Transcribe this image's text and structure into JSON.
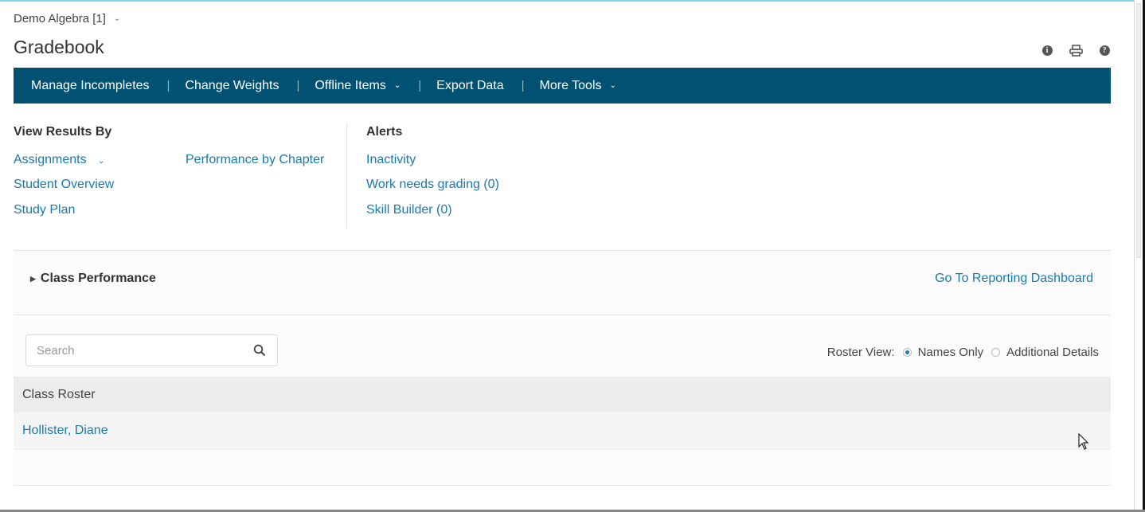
{
  "course": {
    "name": "Demo Algebra [1]",
    "icon": "chevron-down-icon"
  },
  "header": {
    "title": "Gradebook",
    "icons": [
      "info-icon",
      "print-icon",
      "help-icon"
    ]
  },
  "navbar": {
    "bg_color": "#005172",
    "items": [
      {
        "label": "Manage Incompletes",
        "has_dropdown": false
      },
      {
        "label": "Change Weights",
        "has_dropdown": false
      },
      {
        "label": "Offline Items",
        "has_dropdown": true
      },
      {
        "label": "Export Data",
        "has_dropdown": false
      },
      {
        "label": "More Tools",
        "has_dropdown": true
      }
    ]
  },
  "view_results": {
    "heading": "View Results By",
    "links": [
      {
        "label": "Assignments",
        "has_dropdown": true
      },
      {
        "label": "Performance by Chapter"
      },
      {
        "label": "Student Overview"
      },
      {
        "label": "Study Plan"
      }
    ]
  },
  "alerts": {
    "heading": "Alerts",
    "links": [
      {
        "label": "Inactivity"
      },
      {
        "label": "Work needs grading (0)"
      },
      {
        "label": "Skill Builder (0)"
      }
    ]
  },
  "class_performance": {
    "label": "Class Performance",
    "expanded": false,
    "dashboard_link": "Go To Reporting Dashboard"
  },
  "roster": {
    "search_placeholder": "Search",
    "search_value": "",
    "view_label": "Roster View:",
    "view_options": [
      {
        "label": "Names Only",
        "selected": true
      },
      {
        "label": "Additional Details",
        "selected": false
      }
    ],
    "column_header": "Class Roster",
    "students": [
      "Hollister, Diane"
    ]
  },
  "colors": {
    "link": "#1a7aab",
    "accent_line": "#7fd3e6"
  }
}
